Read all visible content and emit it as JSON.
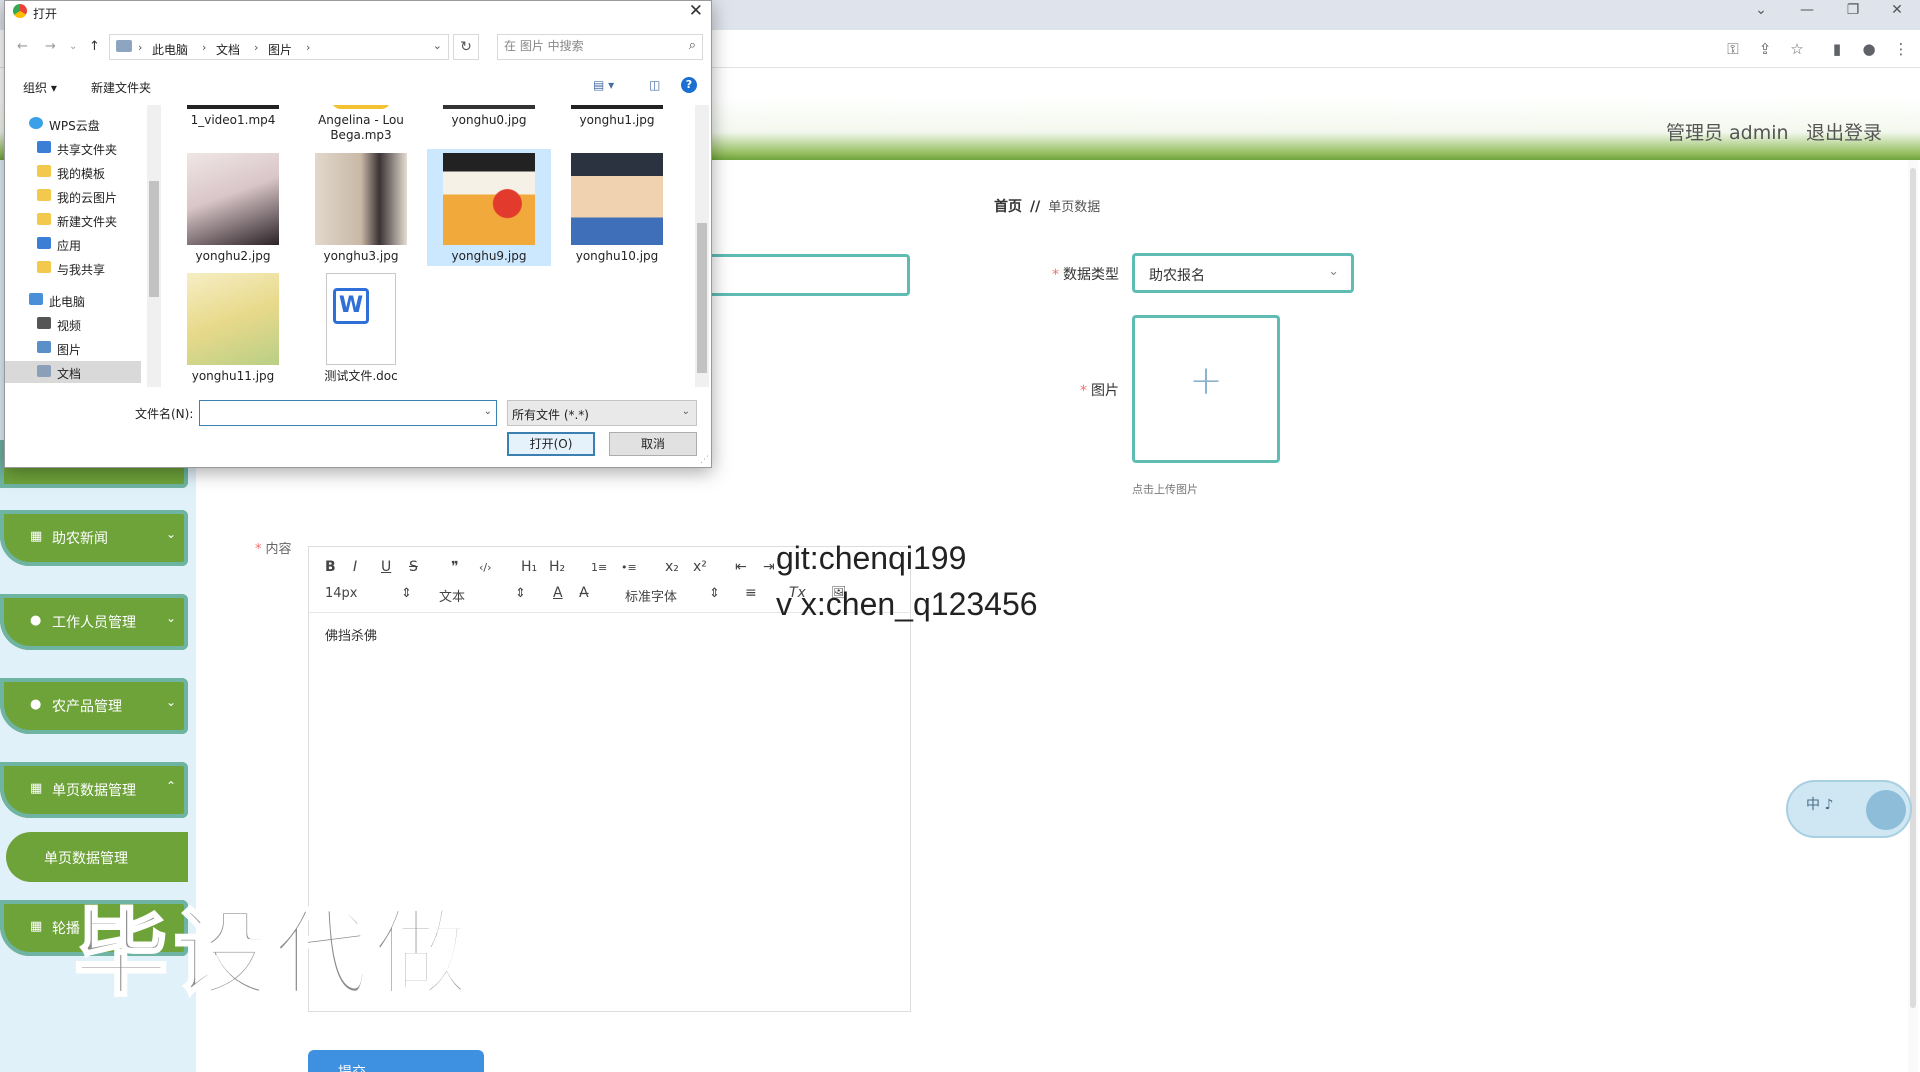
{
  "browser": {
    "window_controls": [
      "⌄",
      "—",
      "❐",
      "✕"
    ],
    "addr_icons": [
      "key-icon",
      "share-icon",
      "star-icon",
      "sidebar-icon",
      "profile-icon",
      "menu-icon"
    ]
  },
  "header": {
    "user": "管理员 admin",
    "logout": "退出登录"
  },
  "sidebar": {
    "items": [
      {
        "label": "助农新闻"
      },
      {
        "label": "工作人员管理"
      },
      {
        "label": "农产品管理"
      },
      {
        "label": "单页数据管理"
      },
      {
        "label": "轮播"
      }
    ],
    "sub_item": "单页数据管理"
  },
  "breadcrumb": {
    "home": "首页",
    "sep": "//",
    "current": "单页数据"
  },
  "form": {
    "type_label": "数据类型",
    "type_value": "助农报名",
    "image_label": "图片",
    "upload_tip": "点击上传图片",
    "content_label": "内容",
    "content_text": "佛挡杀佛",
    "submit": "提交"
  },
  "editor": {
    "toolbar1": [
      "B",
      "I",
      "U",
      "S",
      "❞",
      "‹/›",
      "H₁",
      "H₂",
      "1≡",
      "•≡",
      "x₂",
      "x²",
      "⇤",
      "⇥"
    ],
    "font_size": "14px",
    "paragraph": "文本",
    "font_family": "标准字体",
    "toolbar2": [
      "A",
      "A̶",
      "≡",
      "Tx",
      "🖼"
    ]
  },
  "watermarks": {
    "git": "git:chenqi199",
    "vx": "v x:chen_q123456",
    "big": "毕设代做"
  },
  "float_widget": {
    "text": "中 ♪"
  },
  "dialog": {
    "title": "打开",
    "path": [
      "此电脑",
      "文档",
      "图片"
    ],
    "search_placeholder": "在 图片 中搜索",
    "organize": "组织 ▾",
    "new_folder": "新建文件夹",
    "nav": [
      {
        "label": "WPS云盘",
        "color": "#3aa0e8"
      },
      {
        "label": "共享文件夹",
        "color": "#3a7fd5"
      },
      {
        "label": "我的模板",
        "color": "#f2c94c"
      },
      {
        "label": "我的云图片",
        "color": "#f2c94c"
      },
      {
        "label": "新建文件夹",
        "color": "#f2c94c"
      },
      {
        "label": "应用",
        "color": "#3a7fd5"
      },
      {
        "label": "与我共享",
        "color": "#f2c94c"
      },
      {
        "label": "此电脑",
        "color": "#4a90d9"
      },
      {
        "label": "视频",
        "color": "#555"
      },
      {
        "label": "图片",
        "color": "#5b8fc7"
      },
      {
        "label": "文档",
        "color": "#8aa0b8"
      }
    ],
    "files_top": [
      "1_video1.mp4",
      "Angelina - Lou Bega.mp3",
      "yonghu0.jpg",
      "yonghu1.jpg"
    ],
    "files": [
      {
        "name": "yonghu2.jpg",
        "c1": "#e9dfe0",
        "c2": "#2b2227"
      },
      {
        "name": "yonghu3.jpg",
        "c1": "#d8cfc4",
        "c2": "#6b5548"
      },
      {
        "name": "yonghu9.jpg",
        "c1": "#f2a93b",
        "c2": "#e23a2c"
      },
      {
        "name": "yonghu10.jpg",
        "c1": "#3f6fb8",
        "c2": "#f0d2b0"
      },
      {
        "name": "yonghu11.jpg",
        "c1": "#f1e7b0",
        "c2": "#c9d88a"
      },
      {
        "name": "测试文件.doc",
        "c1": "#ffffff",
        "c2": "#2e6fd8"
      }
    ],
    "filename_label": "文件名(N):",
    "filename_value": "",
    "filetype": "所有文件 (*.*)",
    "open": "打开(O)",
    "cancel": "取消"
  }
}
